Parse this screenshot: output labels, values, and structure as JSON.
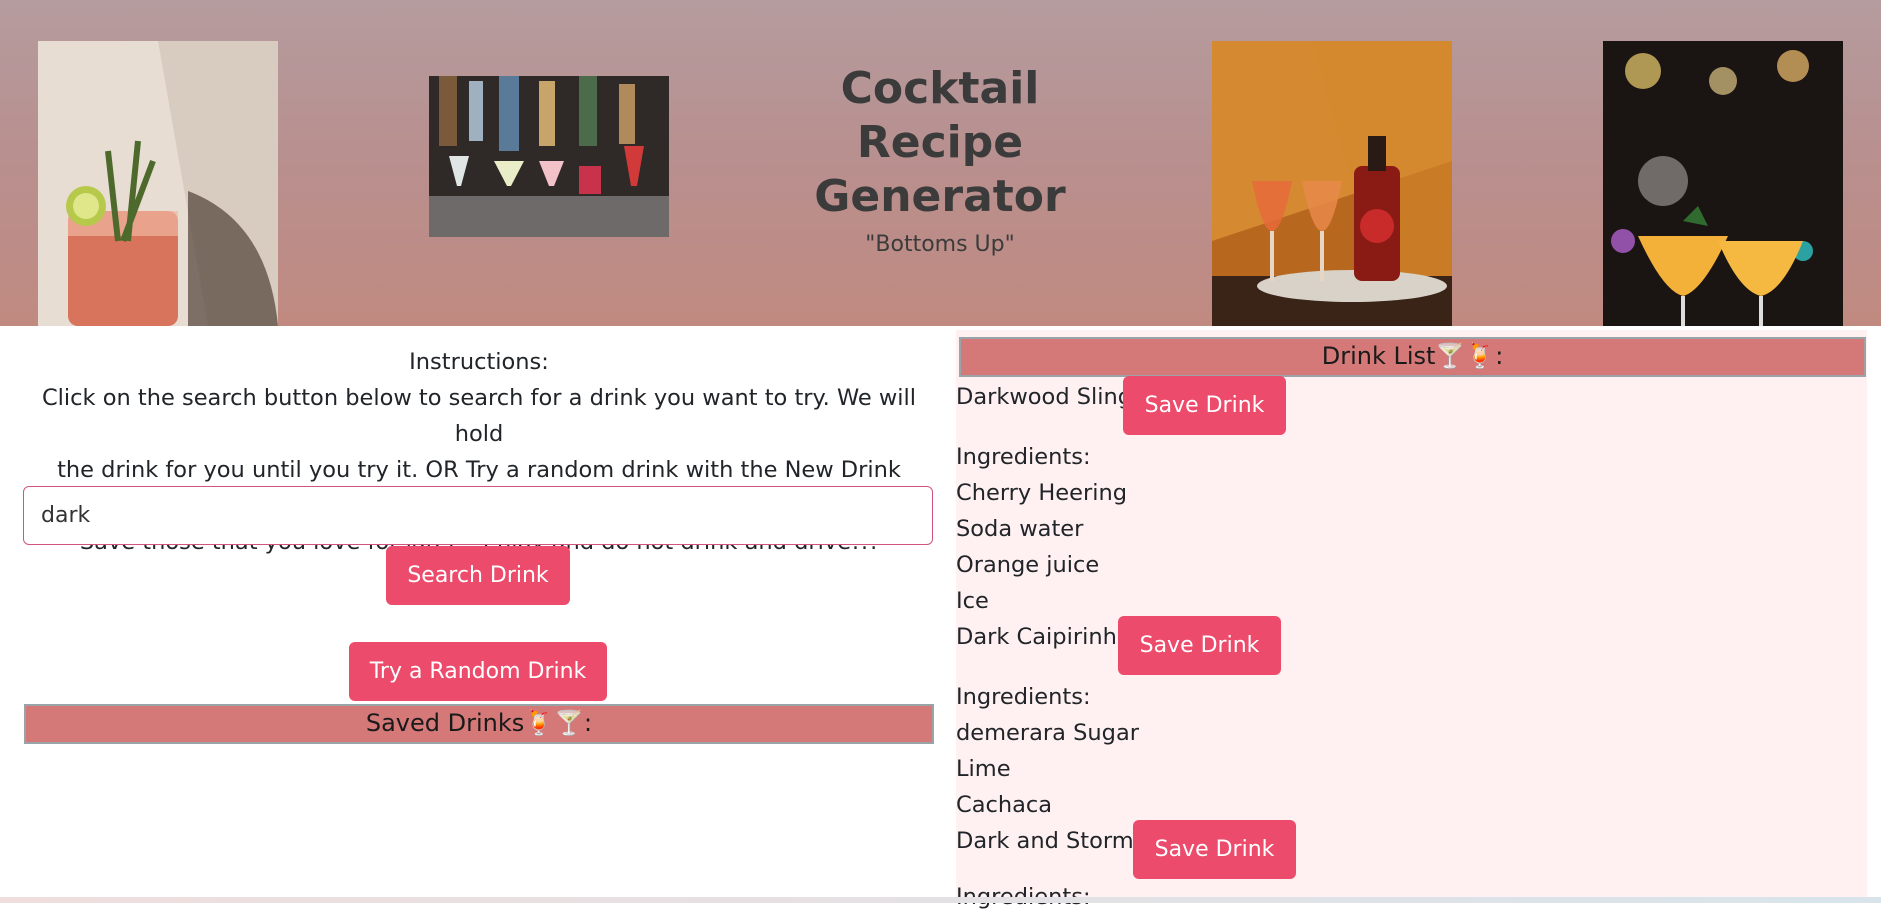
{
  "header": {
    "title_line1": "Cocktail",
    "title_line2": "Recipe",
    "title_line3": "Generator",
    "subtitle": "\"Bottoms Up\"",
    "images": [
      "cocktail-rosemary-photo",
      "bar-glasses-photo",
      "bottle-and-glasses-photo",
      "margarita-photo"
    ]
  },
  "instructions": {
    "heading": "Instructions:",
    "line1": "Click on the search button below to search for a drink you want to try. We will hold",
    "line2": "the drink for you until you try it. OR Try a random drink with the New Drink button.",
    "line3": "Save those that you love for later!! Enjoy and do not drink and drive!!!"
  },
  "search": {
    "value": "dark",
    "button_label": "Search Drink"
  },
  "random_button_label": "Try a Random Drink",
  "saved_drinks": {
    "heading": "Saved Drinks🍹🍸:"
  },
  "drink_list": {
    "heading": "Drink List🍸🍹:",
    "ingredients_label": "Ingredients:",
    "save_label": "Save Drink",
    "drinks": [
      {
        "name": "Darkwood Sling",
        "ingredients": [
          "Cherry Heering",
          "Soda water",
          "Orange juice",
          "Ice"
        ]
      },
      {
        "name": "Dark Caipirinha",
        "ingredients": [
          "demerara Sugar",
          "Lime",
          "Cachaca"
        ]
      },
      {
        "name": "Dark and Stormy",
        "ingredients": []
      }
    ]
  },
  "colors": {
    "accent_button": "#ec4b6c",
    "section_bar": "#d47878",
    "list_background": "#fff1f1"
  }
}
